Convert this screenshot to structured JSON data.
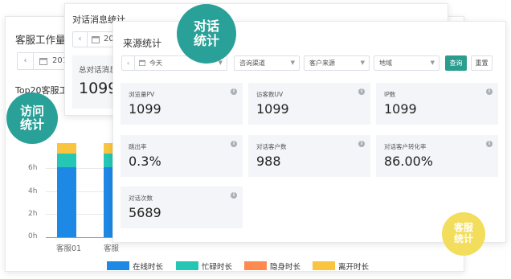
{
  "workload": {
    "title": "客服工作量统",
    "date_value": "2019",
    "subtitle": "Top20客服工作",
    "chart_data": {
      "type": "bar",
      "stacked": true,
      "categories": [
        "客服01",
        "客服02"
      ],
      "yaxis_ticks": [
        "0h",
        "2h",
        "4h",
        "6h"
      ],
      "ylim": [
        0,
        8
      ],
      "series": [
        {
          "name": "在线时长",
          "color": "#1e88e5",
          "values": [
            6.1,
            6.1
          ]
        },
        {
          "name": "忙碌时长",
          "color": "#26c6b5",
          "values": [
            1.2,
            1.2
          ]
        },
        {
          "name": "隐身时长",
          "color": "#ff8a50",
          "values": [
            0,
            0
          ]
        },
        {
          "name": "离开时长",
          "color": "#f9c440",
          "values": [
            0.9,
            0.9
          ]
        }
      ]
    },
    "x_labels_visible": [
      "客服01",
      "客服"
    ]
  },
  "messages": {
    "title": "对话消息统计",
    "date_value": "201",
    "total_label": "总对话消息",
    "total_value": "1099"
  },
  "source": {
    "title": "来源统计",
    "filters": {
      "date": "今天",
      "channel": "咨询渠道",
      "customer_source": "客户来源",
      "region": "地域"
    },
    "buttons": {
      "query": "查询",
      "reset": "重置"
    },
    "stats": [
      {
        "label": "浏览量PV",
        "value": "1099"
      },
      {
        "label": "访客数UV",
        "value": "1099"
      },
      {
        "label": "IP数",
        "value": "1099"
      },
      {
        "label": "跳出率",
        "value": "0.3%"
      },
      {
        "label": "对话客户数",
        "value": "988"
      },
      {
        "label": "对话客户转化率",
        "value": "86.00%"
      },
      {
        "label": "对话次数",
        "value": "5689"
      }
    ]
  },
  "bubbles": {
    "visit": [
      "访问",
      "统计"
    ],
    "chat": [
      "对话",
      "统计"
    ],
    "service": [
      "客服",
      "统计"
    ]
  },
  "icons": {
    "prev": "chevron-left-icon",
    "calendar": "calendar-icon",
    "caret": "caret-down-icon",
    "info": "info-icon"
  }
}
